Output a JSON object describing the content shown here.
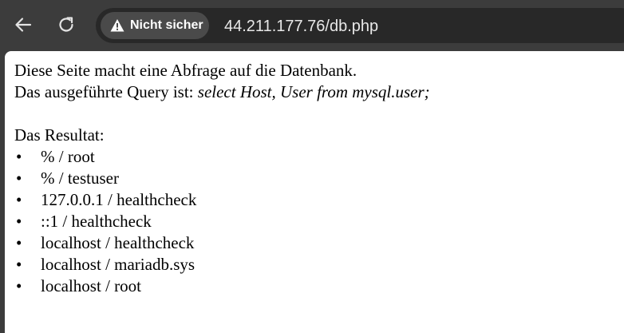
{
  "browser": {
    "security_label": "Nicht sicher",
    "url": "44.211.177.76/db.php",
    "icons": [
      "back-arrow-icon",
      "reload-icon",
      "warning-triangle-icon"
    ]
  },
  "page": {
    "intro_line": "Diese Seite macht eine Abfrage auf die Datenbank.",
    "query_prefix": "Das ausgeführte Query ist: ",
    "query": "select Host, User from mysql.user;",
    "result_heading": "Das Resultat:",
    "bullet": "•",
    "results": [
      "% / root",
      "% / testuser",
      "127.0.0.1 / healthcheck",
      "::1 / healthcheck",
      "localhost / healthcheck",
      "localhost / mariadb.sys",
      "localhost / root"
    ]
  }
}
